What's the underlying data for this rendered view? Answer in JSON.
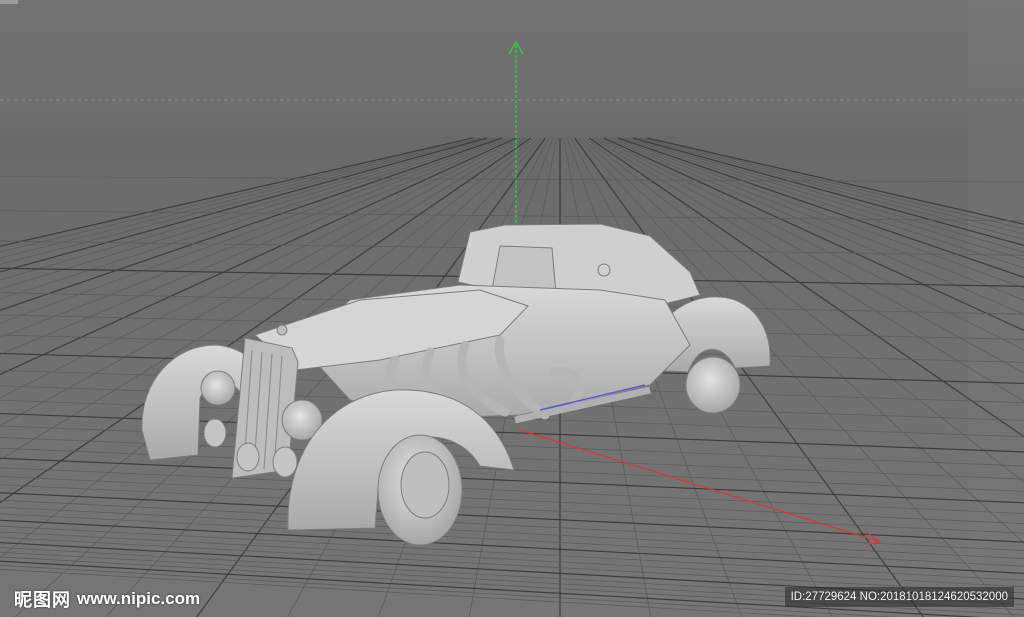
{
  "viewport": {
    "background": "#6e6e6e",
    "grid_color": "#5c5c5c",
    "major_grid_color": "#3f3f3f",
    "axis_y_color": "#2ecc40",
    "axis_x_color": "#d63a2f",
    "model_color": "#c9c9c9"
  },
  "watermark": {
    "logo_text": "昵图网",
    "site_url": "www.nipic.com",
    "id_text": "ID:27729624 NO:20181018124620532000"
  }
}
